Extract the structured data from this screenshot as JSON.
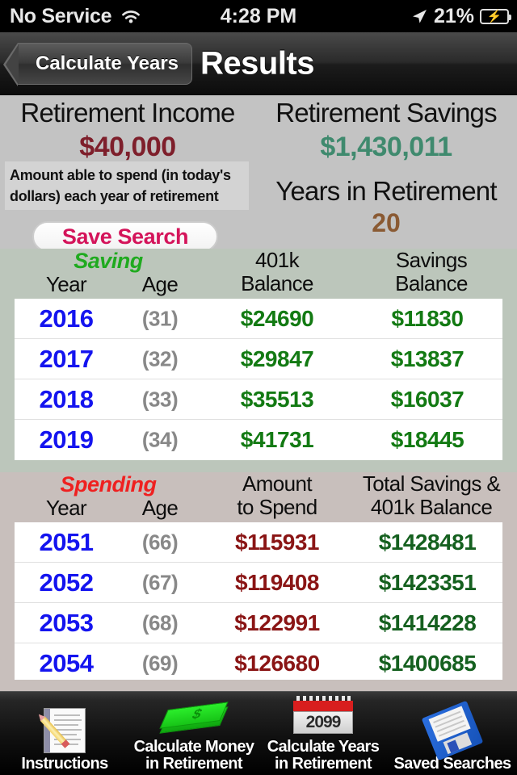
{
  "status_bar": {
    "carrier": "No Service",
    "wifi_icon": "wifi-icon",
    "time": "4:28 PM",
    "location_icon": "location-arrow-icon",
    "battery_percent": "21%",
    "battery_icon": "battery-charging-icon"
  },
  "nav_bar": {
    "back_label": "Calculate Years",
    "title": "Results"
  },
  "summary": {
    "income_heading": "Retirement Income",
    "income_value": "$40,000",
    "income_color": "#7e1f2b",
    "note": "Amount able to spend (in today's dollars) each year of retirement",
    "save_button": "Save Search",
    "save_button_color": "#d4145a",
    "savings_heading": "Retirement Savings",
    "savings_value": "$1,430,011",
    "savings_color": "#3f8a6e",
    "years_heading": "Years in Retirement",
    "years_value": "20",
    "years_color": "#8a5a33"
  },
  "saving_table": {
    "tag": "Saving",
    "tag_color": "#1faa1f",
    "bg_color": "#bcc6bb",
    "columns": [
      "Year",
      "Age",
      "401k\nBalance",
      "Savings\nBalance"
    ],
    "col3_line1": "401k",
    "col3_line2": "Balance",
    "col4_line1": "Savings",
    "col4_line2": "Balance",
    "rows": [
      {
        "year": "2016",
        "age": "(31)",
        "v1": "$24690",
        "v2": "$11830"
      },
      {
        "year": "2017",
        "age": "(32)",
        "v1": "$29847",
        "v2": "$13837"
      },
      {
        "year": "2018",
        "age": "(33)",
        "v1": "$35513",
        "v2": "$16037"
      },
      {
        "year": "2019",
        "age": "(34)",
        "v1": "$41731",
        "v2": "$18445"
      }
    ],
    "v1_color": "#137a13",
    "v2_color": "#137a13"
  },
  "spending_table": {
    "tag": "Spending",
    "tag_color": "#ef2020",
    "bg_color": "#c8bfbc",
    "col3_line1": "Amount",
    "col3_line2": "to Spend",
    "col4_line1": "Total Savings &",
    "col4_line2": "401k Balance",
    "columns": [
      "Year",
      "Age",
      "Amount to Spend",
      "Total Savings & 401k Balance"
    ],
    "rows": [
      {
        "year": "2051",
        "age": "(66)",
        "v1": "$115931",
        "v2": "$1428481"
      },
      {
        "year": "2052",
        "age": "(67)",
        "v1": "$119408",
        "v2": "$1423351"
      },
      {
        "year": "2053",
        "age": "(68)",
        "v1": "$122991",
        "v2": "$1414228"
      },
      {
        "year": "2054",
        "age": "(69)",
        "v1": "$126680",
        "v2": "$1400685"
      }
    ],
    "v1_color": "#8a1515",
    "v2_color": "#15601f"
  },
  "tab_bar": {
    "tabs": [
      {
        "label": "Instructions",
        "icon": "document-pencil-icon"
      },
      {
        "label": "Calculate Money in Retirement",
        "line1": "Calculate Money",
        "line2": "in Retirement",
        "icon": "money-stack-icon"
      },
      {
        "label": "Calculate Years in Retirement",
        "line1": "Calculate Years",
        "line2": "in Retirement",
        "icon": "calendar-icon",
        "calendar_year": "2099"
      },
      {
        "label": "Saved Searches",
        "icon": "floppy-disk-icon"
      }
    ]
  }
}
